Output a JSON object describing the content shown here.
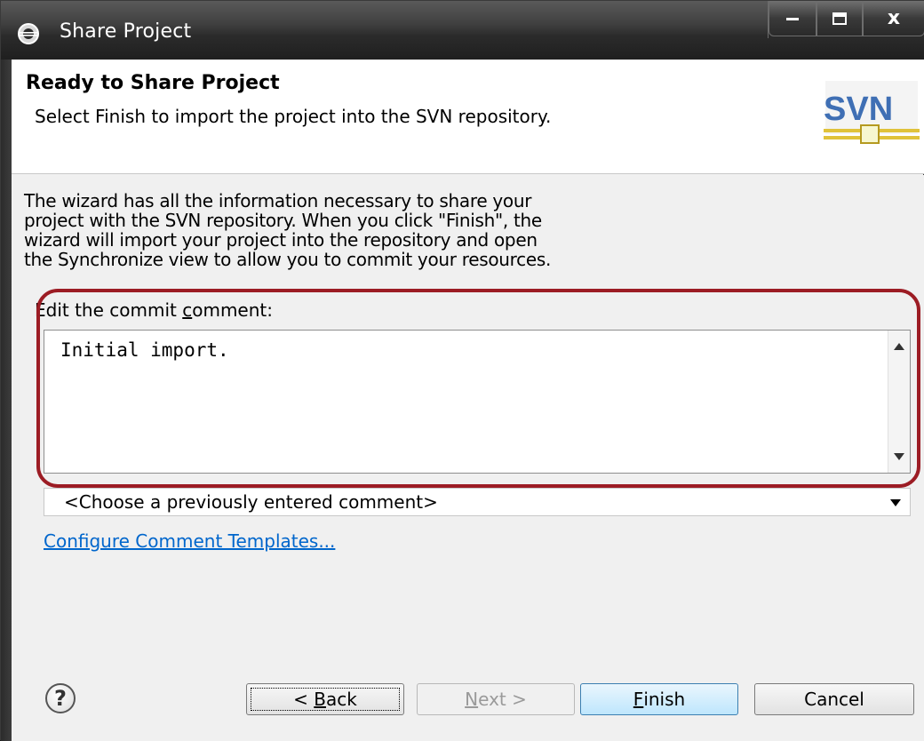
{
  "window": {
    "title": "Share Project",
    "controls": {
      "minimize_icon": "minimize-icon",
      "maximize_icon": "maximize-icon",
      "close_glyph": "x"
    }
  },
  "header": {
    "title": "Ready to Share Project",
    "description": "Select Finish to import the project into the SVN repository.",
    "logo_text": "SVN"
  },
  "body": {
    "intro": "The wizard has all the information necessary to share your\nproject with the SVN repository. When you click \"Finish\", the\nwizard will import your project into the repository and open\nthe Synchronize view to allow you to commit your resources.",
    "comment_label_prefix": "Edit the commit ",
    "comment_label_mnemonic": "c",
    "comment_label_suffix": "omment:",
    "comment_value": "Initial import.",
    "previous_comment_selected": "<Choose a previously entered comment>",
    "templates_link": "Configure Comment Templates..."
  },
  "buttons": {
    "back_prefix": "< ",
    "back_mnemonic": "B",
    "back_suffix": "ack",
    "next_mnemonic": "N",
    "next_suffix": "ext >",
    "finish_mnemonic": "F",
    "finish_suffix": "inish",
    "cancel": "Cancel"
  },
  "colors": {
    "highlight": "#9c1c24",
    "link": "#0066cc",
    "title_bar": "#2b2b2b"
  }
}
